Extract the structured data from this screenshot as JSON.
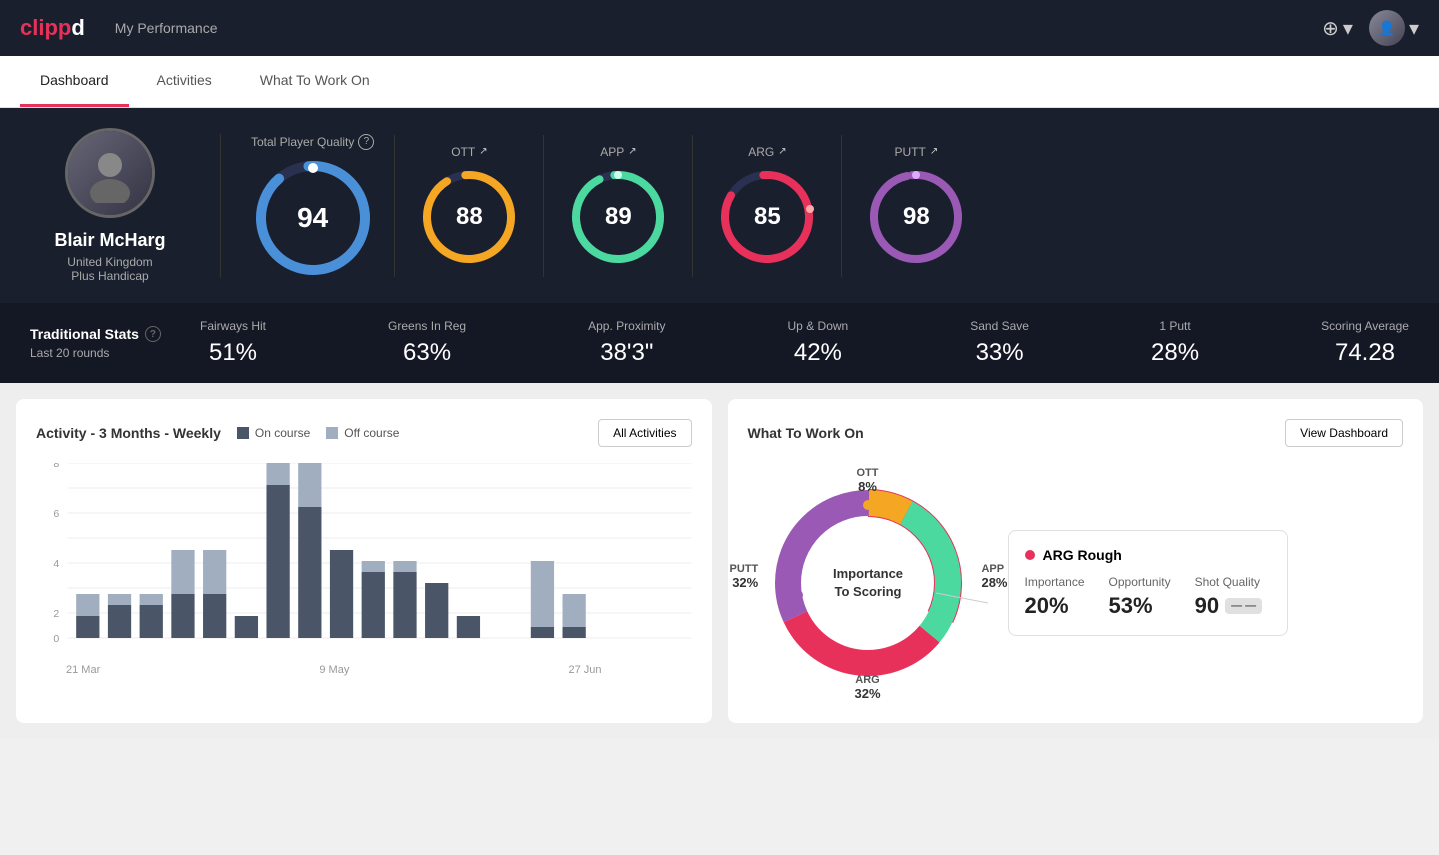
{
  "header": {
    "logo": "clippd",
    "title": "My Performance",
    "add_icon": "⊕",
    "chevron": "▾"
  },
  "tabs": [
    {
      "label": "Dashboard",
      "active": true
    },
    {
      "label": "Activities",
      "active": false
    },
    {
      "label": "What To Work On",
      "active": false
    }
  ],
  "player": {
    "name": "Blair McHarg",
    "country": "United Kingdom",
    "handicap": "Plus Handicap"
  },
  "quality": {
    "label": "Total Player Quality",
    "main_score": 94,
    "metrics": [
      {
        "label": "OTT",
        "score": 88,
        "color": "#f5a623",
        "bg": "#f5a623"
      },
      {
        "label": "APP",
        "score": 89,
        "color": "#4cd9a0",
        "bg": "#4cd9a0"
      },
      {
        "label": "ARG",
        "score": 85,
        "color": "#e8315a",
        "bg": "#e8315a"
      },
      {
        "label": "PUTT",
        "score": 98,
        "color": "#9b59b6",
        "bg": "#9b59b6"
      }
    ]
  },
  "trad_stats": {
    "title": "Traditional Stats",
    "subtitle": "Last 20 rounds",
    "items": [
      {
        "label": "Fairways Hit",
        "value": "51%"
      },
      {
        "label": "Greens In Reg",
        "value": "63%"
      },
      {
        "label": "App. Proximity",
        "value": "38'3\""
      },
      {
        "label": "Up & Down",
        "value": "42%"
      },
      {
        "label": "Sand Save",
        "value": "33%"
      },
      {
        "label": "1 Putt",
        "value": "28%"
      },
      {
        "label": "Scoring Average",
        "value": "74.28"
      }
    ]
  },
  "activity": {
    "title": "Activity - 3 Months - Weekly",
    "legend_on": "On course",
    "legend_off": "Off course",
    "btn_label": "All Activities",
    "x_labels": [
      "21 Mar",
      "9 May",
      "27 Jun"
    ],
    "bars": [
      {
        "on": 1,
        "off": 1
      },
      {
        "on": 1.5,
        "off": 0.5
      },
      {
        "on": 1.5,
        "off": 0.5
      },
      {
        "on": 2,
        "off": 2
      },
      {
        "on": 2,
        "off": 2
      },
      {
        "on": 1,
        "off": 0
      },
      {
        "on": 7,
        "off": 2
      },
      {
        "on": 6,
        "off": 2.5
      },
      {
        "on": 4,
        "off": 0
      },
      {
        "on": 3,
        "off": 0.5
      },
      {
        "on": 3,
        "off": 0.5
      },
      {
        "on": 2.5,
        "off": 0
      },
      {
        "on": 1,
        "off": 0
      },
      {
        "on": 0.5,
        "off": 3
      },
      {
        "on": 0.5,
        "off": 1.5
      }
    ],
    "y_max": 8
  },
  "wtwo": {
    "title": "What To Work On",
    "btn_label": "View Dashboard",
    "donut_center": "Importance\nTo Scoring",
    "segments": [
      {
        "label": "OTT",
        "value": "8%",
        "color": "#f5a623",
        "position": "top"
      },
      {
        "label": "APP",
        "value": "28%",
        "color": "#4cd9a0",
        "position": "right"
      },
      {
        "label": "ARG",
        "value": "32%",
        "color": "#e8315a",
        "position": "bottom"
      },
      {
        "label": "PUTT",
        "value": "32%",
        "color": "#9b59b6",
        "position": "left"
      }
    ],
    "info_card": {
      "title": "ARG Rough",
      "dot_color": "#e8315a",
      "metrics": [
        {
          "label": "Importance",
          "value": "20%"
        },
        {
          "label": "Opportunity",
          "value": "53%"
        },
        {
          "label": "Shot Quality",
          "value": "90",
          "tag": ""
        }
      ]
    }
  },
  "colors": {
    "primary": "#e8315a",
    "bg_dark": "#1a1f2e",
    "bg_darker": "#141825",
    "text_light": "#aaaaaa",
    "blue_score": "#4a90d9"
  }
}
